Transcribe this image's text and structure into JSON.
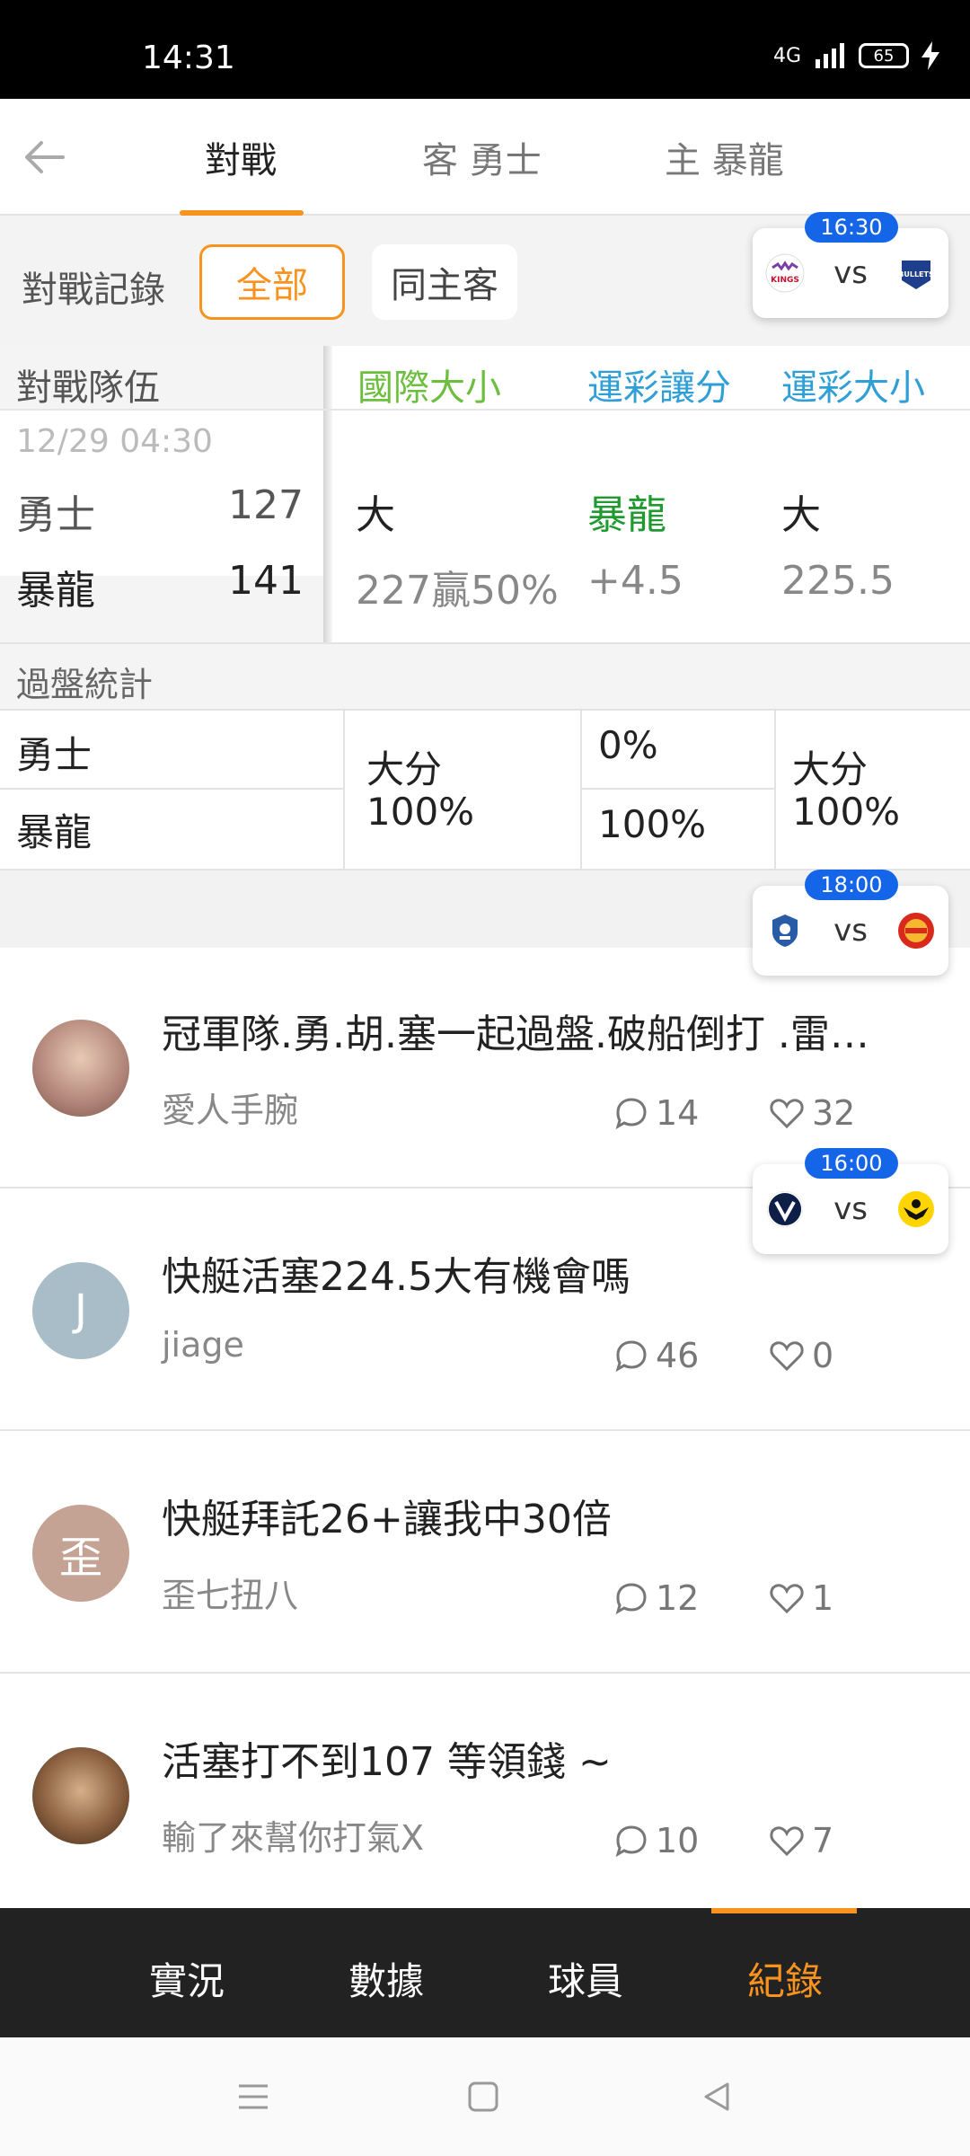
{
  "status_bar": {
    "time": "14:31",
    "network": "4G",
    "battery": "65"
  },
  "tabs": [
    {
      "label": "對戰",
      "active": true
    },
    {
      "label": "客 勇士",
      "active": false
    },
    {
      "label": "主 暴龍",
      "active": false
    }
  ],
  "filter": {
    "label": "對戰記錄",
    "chips": [
      "全部",
      "同主客"
    ]
  },
  "floating_games": [
    {
      "time": "16:30",
      "vs": "vs",
      "home_logo": "kings-logo",
      "away_logo": "bullets-logo"
    },
    {
      "time": "18:00",
      "vs": "vs",
      "home_logo": "blue-crest-logo",
      "away_logo": "red-circle-logo"
    },
    {
      "time": "16:00",
      "vs": "vs",
      "home_logo": "victory-logo",
      "away_logo": "yellow-wings-logo"
    }
  ],
  "table": {
    "headers": [
      "對戰隊伍",
      "國際大小",
      "運彩讓分",
      "運彩大小"
    ],
    "header_colors": {
      "intl": "#6cbf3e",
      "sports": "#2f9fd6"
    },
    "match": {
      "date": "12/29 04:30",
      "away": {
        "team": "勇士",
        "score": "127"
      },
      "home": {
        "team": "暴龍",
        "score": "141"
      },
      "intl": {
        "top": "大",
        "bottom": "227贏50%"
      },
      "spread": {
        "top": "暴龍",
        "bottom": "+4.5"
      },
      "total": {
        "top": "大",
        "bottom": "225.5"
      }
    },
    "stats_label": "過盤統計",
    "stats": {
      "teams": [
        "勇士",
        "暴龍"
      ],
      "col1": {
        "top": "大分",
        "bottom": "100%"
      },
      "col2": {
        "top": "0%",
        "bottom": "100%"
      },
      "col3": {
        "top": "大分",
        "bottom": "100%"
      }
    }
  },
  "posts": [
    {
      "title": "冠軍隊.勇.胡.塞一起過盤.破船倒打 .雷…",
      "author": "愛人手腕",
      "comments": "14",
      "likes": "32",
      "avatar_text": "",
      "avatar_color": "#b08478"
    },
    {
      "title": "快艇活塞224.5大有機會嗎",
      "author": "jiage",
      "comments": "46",
      "likes": "0",
      "avatar_text": "J",
      "avatar_color": "#a9bdc8"
    },
    {
      "title": "快艇拜託26+讓我中30倍",
      "author": "歪七扭八",
      "comments": "12",
      "likes": "1",
      "avatar_text": "歪",
      "avatar_color": "#c4a394"
    },
    {
      "title": "活塞打不到107 等領錢 ~",
      "author": "輸了來幫你打氣X",
      "comments": "10",
      "likes": "7",
      "avatar_text": "",
      "avatar_color": "#6b4a2e"
    }
  ],
  "bottom_nav": [
    {
      "label": "實況",
      "active": false
    },
    {
      "label": "數據",
      "active": false
    },
    {
      "label": "球員",
      "active": false
    },
    {
      "label": "紀錄",
      "active": true
    }
  ],
  "accent_color": "#f7931e"
}
